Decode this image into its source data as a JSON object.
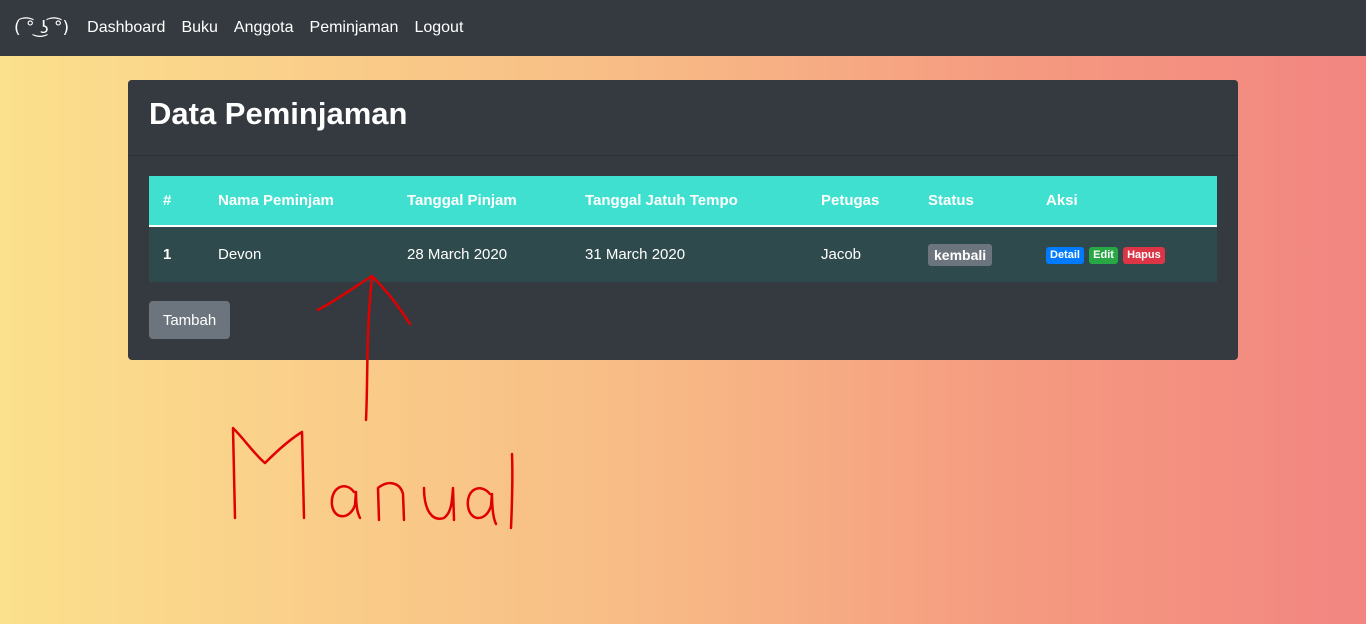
{
  "navbar": {
    "brand": "( ͡° ͜ʖ ͡°)",
    "links": [
      "Dashboard",
      "Buku",
      "Anggota",
      "Peminjaman",
      "Logout"
    ]
  },
  "card": {
    "title": "Data Peminjaman",
    "table": {
      "headers": [
        "#",
        "Nama Peminjam",
        "Tanggal Pinjam",
        "Tanggal Jatuh Tempo",
        "Petugas",
        "Status",
        "Aksi"
      ],
      "rows": [
        {
          "no": "1",
          "nama": "Devon",
          "tanggal_pinjam": "28 March 2020",
          "tanggal_jatuh_tempo": "31 March 2020",
          "petugas": "Jacob",
          "status": "kembali",
          "actions": [
            "Detail",
            "Edit",
            "Hapus"
          ]
        }
      ]
    },
    "add_button": "Tambah"
  },
  "annotation": {
    "text": "Manual",
    "color": "#e00000"
  },
  "colors": {
    "navbar_bg": "#343a40",
    "table_header_bg": "#40e0d0",
    "table_row_bg": "#2e4a4c",
    "detail": "#007bff",
    "edit": "#28a745",
    "hapus": "#dc3545",
    "status": "#6c757d"
  }
}
